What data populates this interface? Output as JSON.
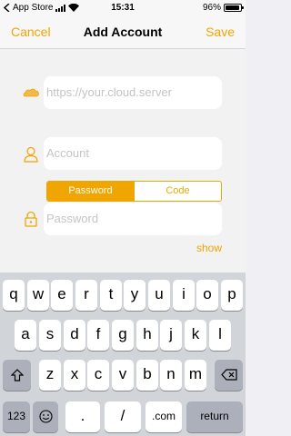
{
  "status_bar": {
    "carrier": "App Store",
    "time": "15:31",
    "battery_text": "96%",
    "battery_level": 0.96
  },
  "nav": {
    "cancel_label": "Cancel",
    "title": "Add Account",
    "save_label": "Save"
  },
  "form": {
    "server_placeholder": "https://your.cloud.server",
    "account_placeholder": "Account",
    "password_placeholder": "Password",
    "auth_tabs": [
      "Password",
      "Code"
    ],
    "auth_selected": "Password",
    "show_label": "show"
  },
  "keyboard": {
    "row1": [
      "q",
      "w",
      "e",
      "r",
      "t",
      "y",
      "u",
      "i",
      "o",
      "p"
    ],
    "row2": [
      "a",
      "s",
      "d",
      "f",
      "g",
      "h",
      "j",
      "k",
      "l"
    ],
    "row3": [
      "z",
      "x",
      "c",
      "v",
      "b",
      "n",
      "m"
    ],
    "numbers_label": "123",
    "dot_label": ".",
    "slash_label": "/",
    "dotcom_label": ".com",
    "return_label": "return"
  },
  "colors": {
    "accent": "#f0a500"
  }
}
